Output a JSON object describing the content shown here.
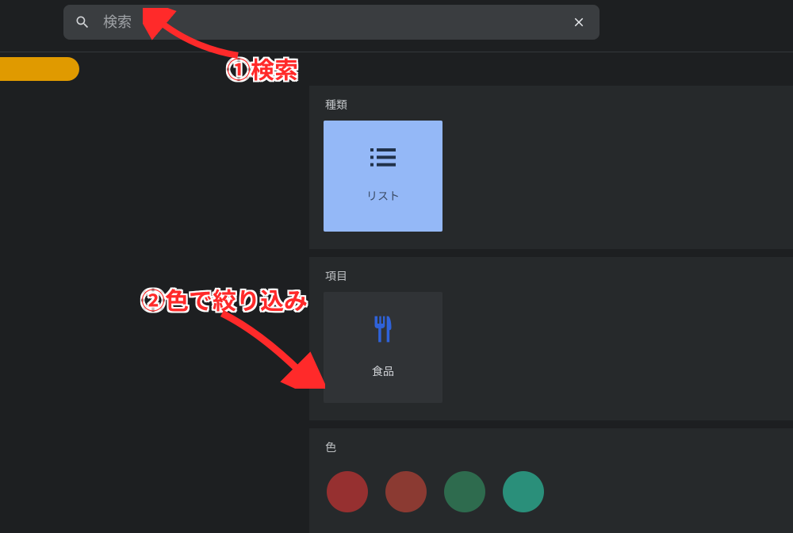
{
  "search": {
    "placeholder": "検索",
    "value": ""
  },
  "sections": {
    "type": {
      "title": "種類",
      "tile_label": "リスト"
    },
    "item": {
      "title": "項目",
      "tile_label": "食品"
    },
    "color": {
      "title": "色",
      "swatches": [
        "#963030",
        "#8b3a32",
        "#2e6b4e",
        "#2a8f7a"
      ]
    }
  },
  "annotations": {
    "anno1": "①検索",
    "anno2": "②色で絞り込み"
  }
}
